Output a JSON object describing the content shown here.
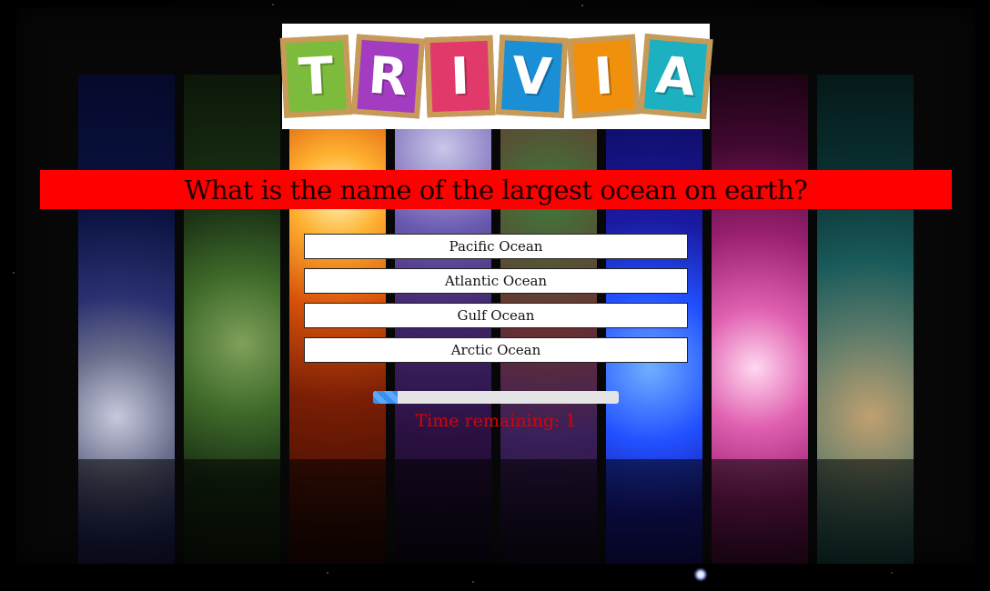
{
  "logo": {
    "letters": [
      "T",
      "R",
      "I",
      "V",
      "I",
      "A"
    ],
    "colors": [
      "#7dbb3c",
      "#a43cc2",
      "#e2396b",
      "#1a8fd6",
      "#f0900c",
      "#1db0c0"
    ]
  },
  "question": {
    "text": "What is the name of the largest ocean on earth?"
  },
  "answers": [
    {
      "label": "Pacific Ocean"
    },
    {
      "label": "Atlantic Ocean"
    },
    {
      "label": "Gulf Ocean"
    },
    {
      "label": "Arctic Ocean"
    }
  ],
  "timer": {
    "label": "Time remaining: 1",
    "progress_fraction": 0.1
  },
  "colors": {
    "question_bar": "#ff0000",
    "timer_text": "#e00000",
    "progress_fill": "#3b8df0"
  }
}
